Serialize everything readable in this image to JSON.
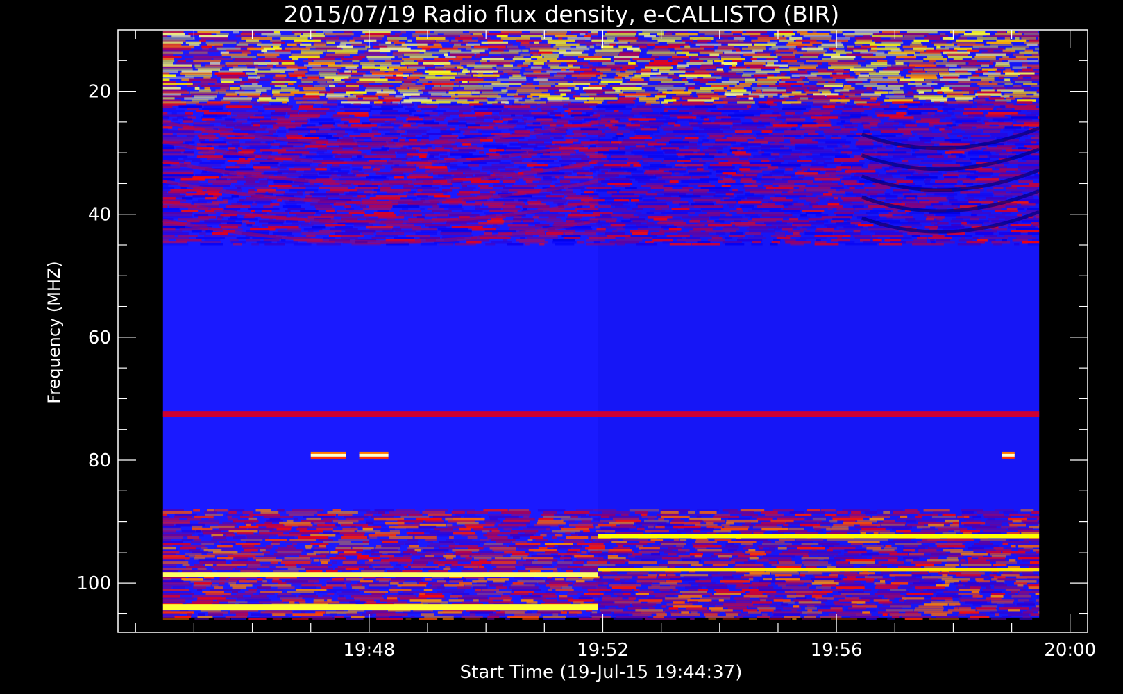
{
  "chart_data": {
    "type": "heatmap",
    "title": "2015/07/19  Radio flux density, e-CALLISTO (BIR)",
    "xlabel": "Start Time (19-Jul-15 19:44:37)",
    "ylabel": "Frequency (MHZ)",
    "x_ticks": [
      "19:48",
      "19:52",
      "19:56",
      "20:00"
    ],
    "y_ticks": [
      20,
      40,
      60,
      80,
      100
    ],
    "xlim_min": [
      -0.3,
      16.3
    ],
    "data_xlim_min": [
      0.47,
      15.47
    ],
    "ylim_mhz": [
      10,
      108
    ],
    "data_ylim_mhz": [
      10.2,
      105.6
    ],
    "grid": false,
    "colormap": [
      "#000000",
      "#0000ff",
      "#ff0000",
      "#ffff00",
      "#ffffff"
    ],
    "background_color": "#1a1aff",
    "instrument_switch_min": 7.92,
    "bands": [
      {
        "from_mhz": 10.2,
        "to_mhz": 22,
        "level": 0.7,
        "segment": "all",
        "noisy": true
      },
      {
        "from_mhz": 22,
        "to_mhz": 45,
        "level": 0.4,
        "segment": "all",
        "noisy": true
      },
      {
        "from_mhz": 72,
        "to_mhz": 73,
        "level": 0.45,
        "segment": "all",
        "noisy": false
      },
      {
        "from_mhz": 88,
        "to_mhz": 106,
        "level": 0.5,
        "segment": "all",
        "noisy": true
      },
      {
        "from_mhz": 98.2,
        "to_mhz": 99.0,
        "level": 0.85,
        "segment": "first",
        "noisy": false
      },
      {
        "from_mhz": 103.5,
        "to_mhz": 104.4,
        "level": 0.8,
        "segment": "first",
        "noisy": false
      },
      {
        "from_mhz": 92.0,
        "to_mhz": 92.7,
        "level": 0.75,
        "segment": "second",
        "noisy": false
      },
      {
        "from_mhz": 97.5,
        "to_mhz": 98.1,
        "level": 0.72,
        "segment": "second",
        "noisy": false
      }
    ],
    "bright_blips": [
      {
        "t_min": 3.0,
        "t_end_min": 3.6,
        "mhz": 79.2
      },
      {
        "t_min": 3.83,
        "t_end_min": 4.33,
        "mhz": 79.2
      },
      {
        "t_min": 14.83,
        "t_end_min": 15.05,
        "mhz": 79.2
      }
    ]
  }
}
